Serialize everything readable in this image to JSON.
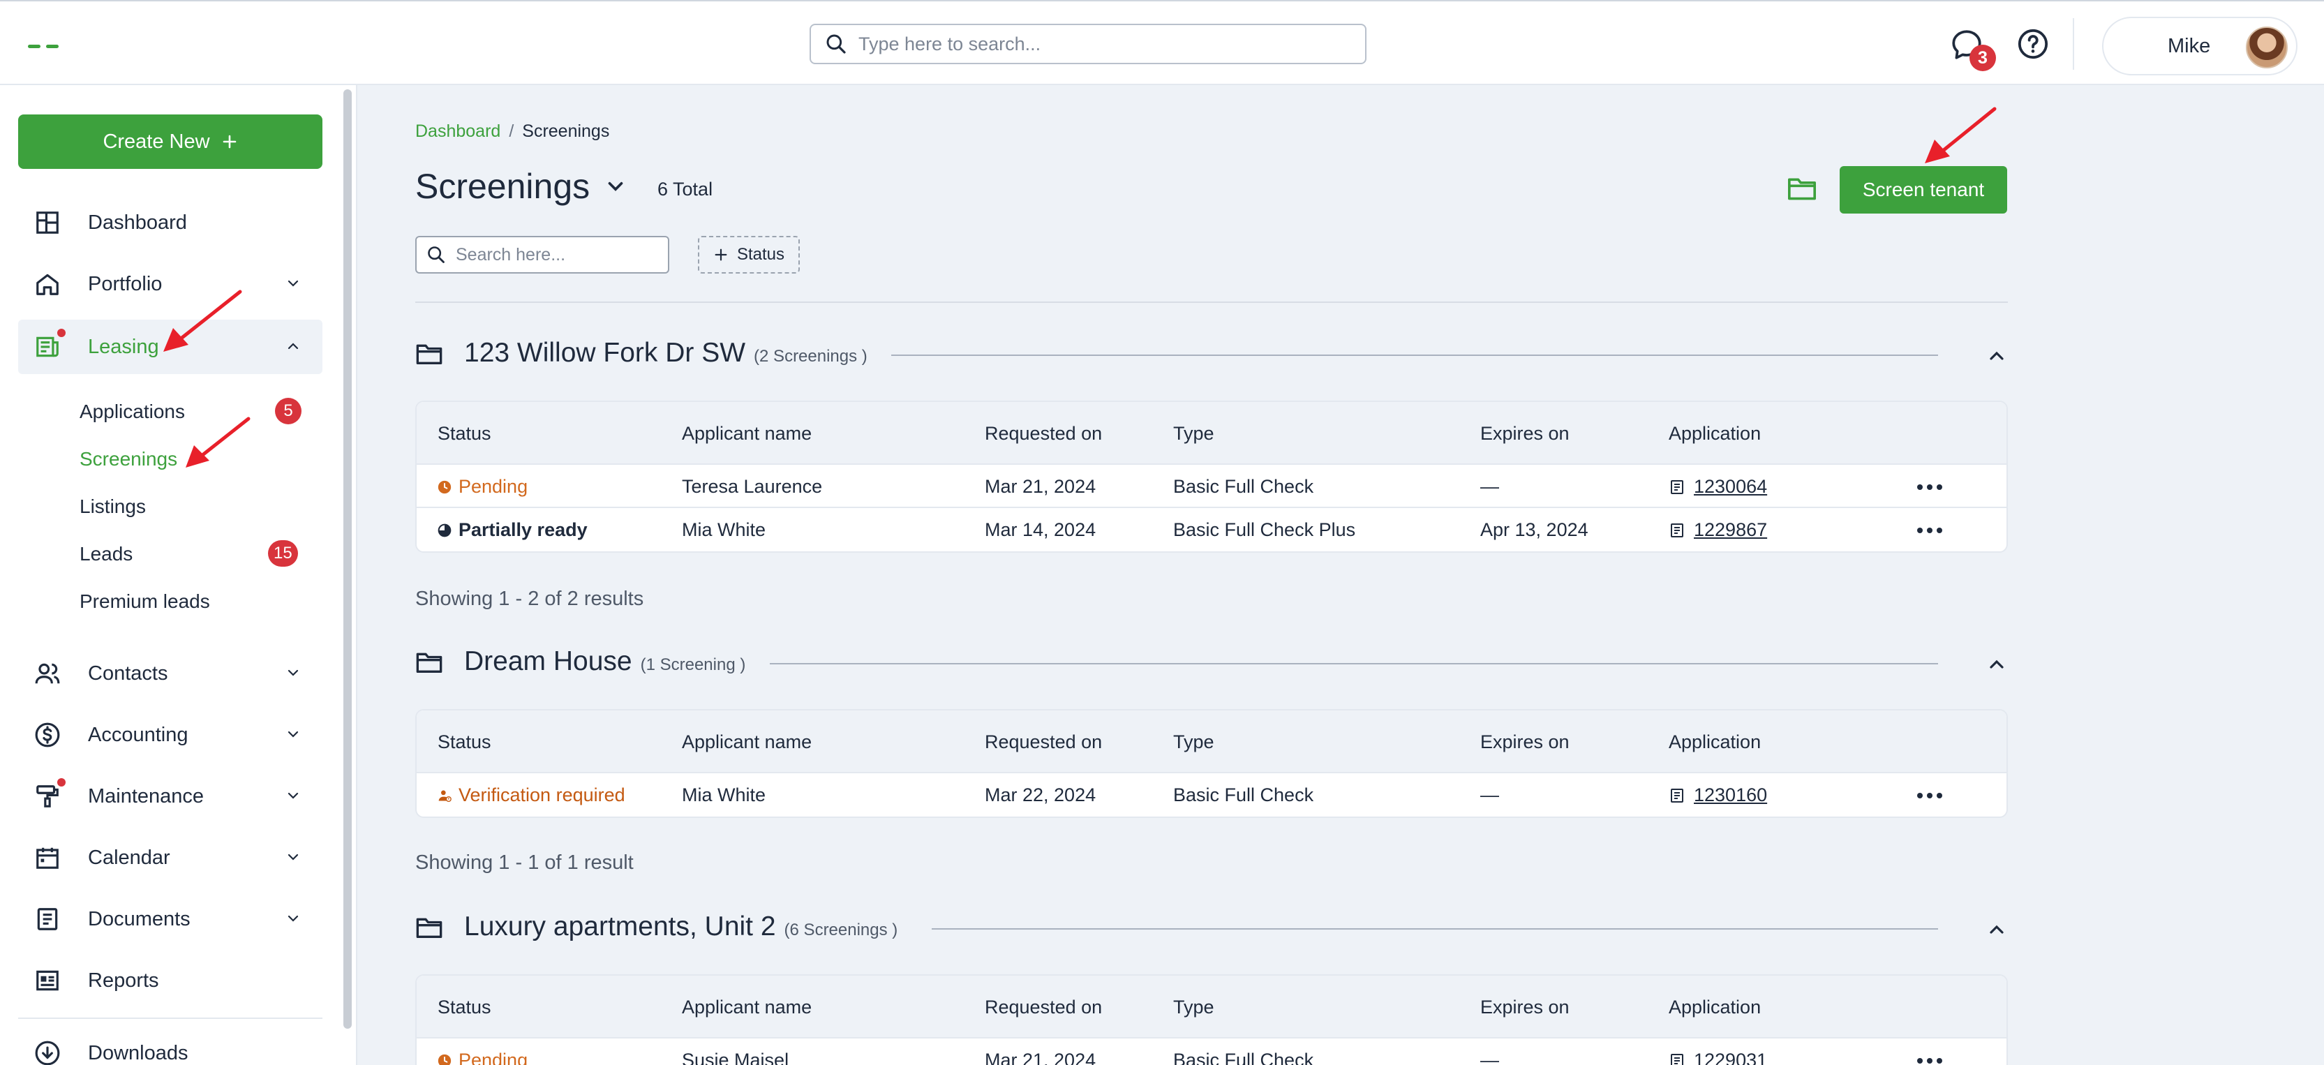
{
  "topbar": {
    "search_placeholder": "Type here to search...",
    "messages_count": "3",
    "user_name": "Mike"
  },
  "sidebar": {
    "create_new_label": "Create New",
    "items": [
      {
        "label": "Dashboard"
      },
      {
        "label": "Portfolio"
      },
      {
        "label": "Leasing"
      },
      {
        "label": "Contacts"
      },
      {
        "label": "Accounting"
      },
      {
        "label": "Maintenance"
      },
      {
        "label": "Calendar"
      },
      {
        "label": "Documents"
      },
      {
        "label": "Reports"
      },
      {
        "label": "Downloads"
      }
    ],
    "leasing_sub": [
      {
        "label": "Applications",
        "badge": "5"
      },
      {
        "label": "Screenings",
        "badge": ""
      },
      {
        "label": "Listings",
        "badge": ""
      },
      {
        "label": "Leads",
        "badge": "15"
      },
      {
        "label": "Premium leads",
        "badge": ""
      }
    ]
  },
  "main": {
    "breadcrumb": {
      "root": "Dashboard",
      "sep": "/",
      "current": "Screenings"
    },
    "title": "Screenings",
    "total": "6 Total",
    "screen_tenant_label": "Screen tenant",
    "search_placeholder": "Search here...",
    "status_filter_label": "Status",
    "columns": [
      "Status",
      "Applicant name",
      "Requested on",
      "Type",
      "Expires on",
      "Application"
    ],
    "groups": [
      {
        "name": "123 Willow Fork Dr SW",
        "count": "(2 Screenings )",
        "results": "Showing 1 - 2 of 2 results",
        "rows": [
          {
            "status": "Pending",
            "applicant": "Teresa Laurence",
            "requested": "Mar 21, 2024",
            "type": "Basic Full Check",
            "expires": "—",
            "application": "1230064"
          },
          {
            "status": "Partially ready",
            "applicant": "Mia White",
            "requested": "Mar 14, 2024",
            "type": "Basic Full Check Plus",
            "expires": "Apr 13, 2024",
            "application": "1229867"
          }
        ]
      },
      {
        "name": "Dream House",
        "count": "(1 Screening )",
        "results": "Showing 1 - 1 of 1 result",
        "rows": [
          {
            "status": "Verification required",
            "applicant": "Mia White",
            "requested": "Mar 22, 2024",
            "type": "Basic Full Check",
            "expires": "—",
            "application": "1230160"
          }
        ]
      },
      {
        "name": "Luxury apartments, Unit 2",
        "count": "(6 Screenings )",
        "rows": [
          {
            "status": "Pending",
            "applicant": "Susie Maisel",
            "requested": "Mar 21, 2024",
            "type": "Basic Full Check",
            "expires": "—",
            "application": "1229031"
          }
        ]
      }
    ]
  },
  "colors": {
    "brand_green": "#3da13d",
    "pending_orange": "#d2691e",
    "verification_orange": "#c45a12",
    "badge_red": "#d8343c",
    "annotation_arrow": "#e8202a"
  }
}
